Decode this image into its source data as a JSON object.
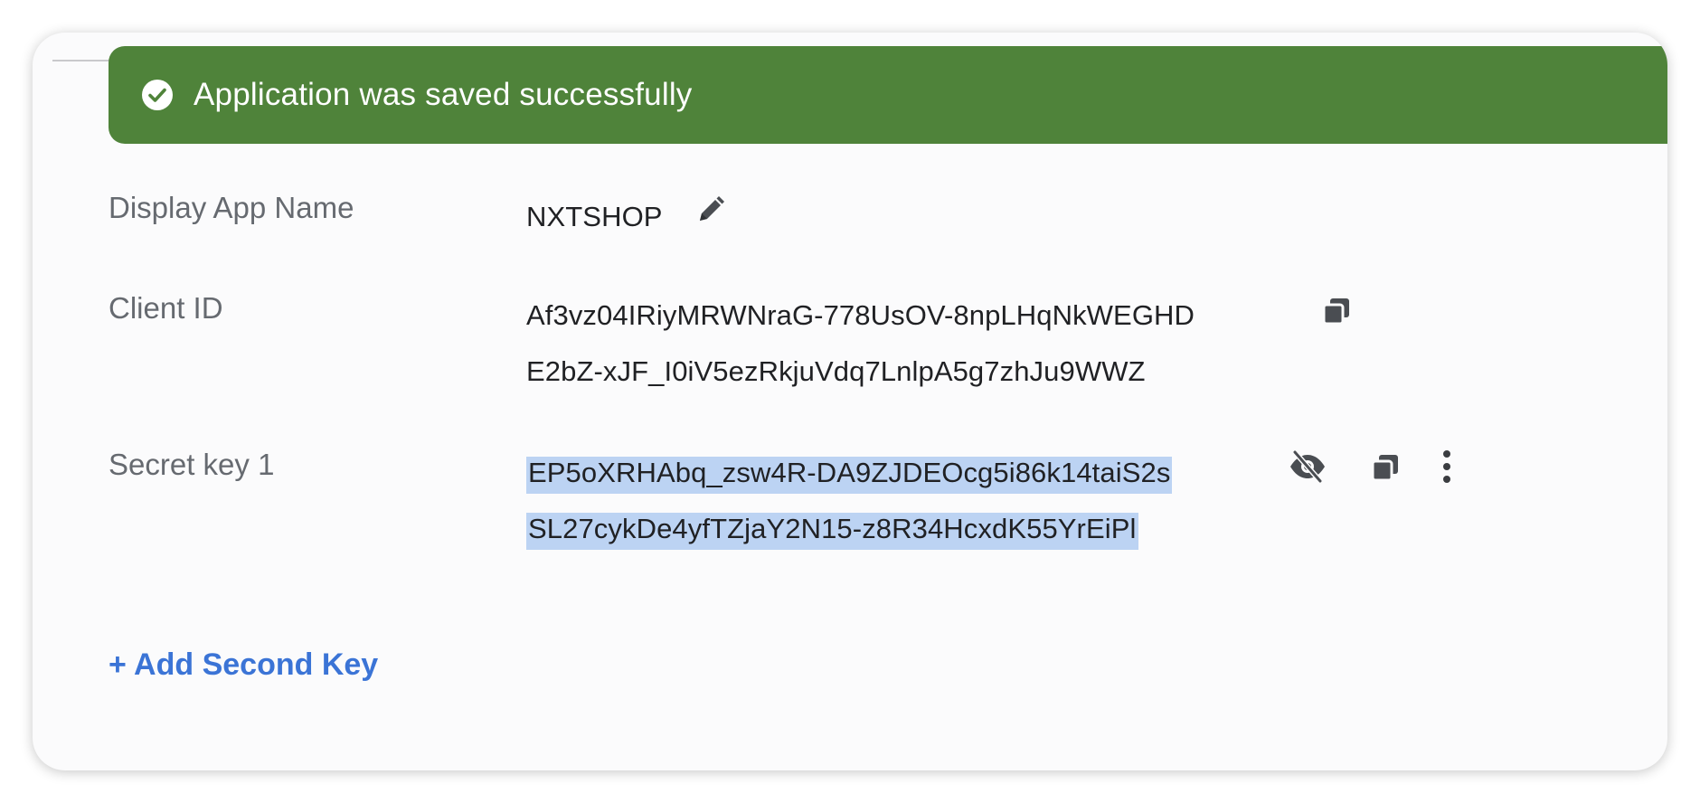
{
  "banner": {
    "message": "Application was saved successfully",
    "icon": "check-circle-icon",
    "color": "#4f833a"
  },
  "fields": {
    "app_name": {
      "label": "Display App Name",
      "value": "NXTSHOP",
      "action_icon": "pencil-icon"
    },
    "client_id": {
      "label": "Client ID",
      "line1": "Af3vz04IRiyMRWNraG-778UsOV-8npLHqNkWEGHD",
      "line2": "E2bZ-xJF_I0iV5ezRkjuVdq7LnlpA5g7zhJu9WWZ",
      "action_icon": "copy-icon"
    },
    "secret_key": {
      "label": "Secret key 1",
      "line1": "EP5oXRHAbq_zsw4R-DA9ZJDEOcg5i86k14taiS2s",
      "line2": "SL27cykDe4yfTZjaY2N15-z8R34HcxdK55YrEiPl",
      "action_icons": [
        "eye-off-icon",
        "copy-icon",
        "more-vertical-icon"
      ],
      "selection_color": "#bcd3f3"
    }
  },
  "actions": {
    "add_second_key": "+ Add Second Key"
  },
  "colors": {
    "link": "#3b74d6",
    "label": "#666a70",
    "value": "#202124"
  }
}
